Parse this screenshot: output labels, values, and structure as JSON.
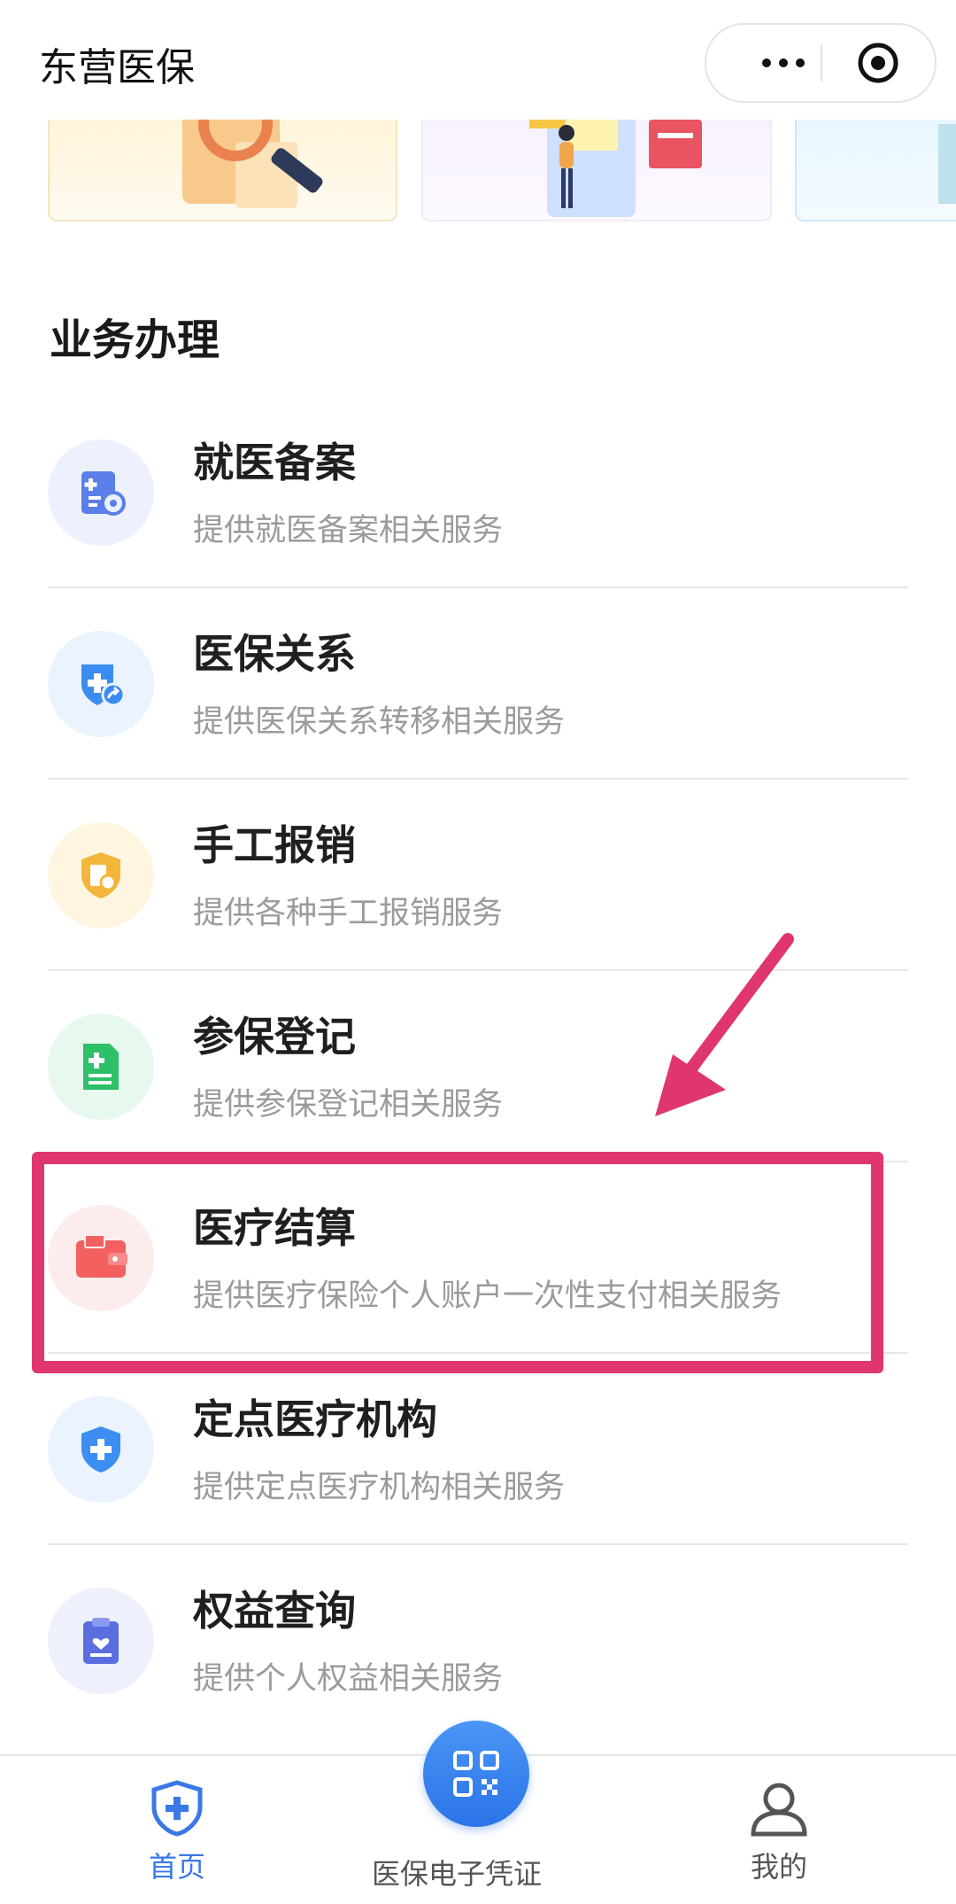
{
  "header": {
    "app_title": "东营医保",
    "more_icon": "more-dots-icon",
    "target_icon": "mini-program-close-icon"
  },
  "section": {
    "title": "业务办理"
  },
  "services": [
    {
      "title": "就医备案",
      "subtitle": "提供就医备案相关服务",
      "icon": "medical-record-gear-icon",
      "color": "#5b7fe8",
      "bg": "#edf1fd"
    },
    {
      "title": "医保关系",
      "subtitle": "提供医保关系转移相关服务",
      "icon": "shield-transfer-icon",
      "color": "#3b8cf0",
      "bg": "#eaf3fe"
    },
    {
      "title": "手工报销",
      "subtitle": "提供各种手工报销服务",
      "icon": "shield-receipt-icon",
      "color": "#f4b63a",
      "bg": "#fff6e2"
    },
    {
      "title": "参保登记",
      "subtitle": "提供参保登记相关服务",
      "icon": "document-plus-icon",
      "color": "#2cc068",
      "bg": "#e7f8ee"
    },
    {
      "title": "医疗结算",
      "subtitle": "提供医疗保险个人账户一次性支付相关服务",
      "icon": "wallet-card-icon",
      "color": "#f26060",
      "bg": "#fdecec"
    },
    {
      "title": "定点医疗机构",
      "subtitle": "提供定点医疗机构相关服务",
      "icon": "shield-plus-icon",
      "color": "#3d8ef2",
      "bg": "#eaf3fe"
    },
    {
      "title": "权益查询",
      "subtitle": "提供个人权益相关服务",
      "icon": "clipboard-heart-icon",
      "color": "#5a6ee0",
      "bg": "#eef0fc"
    }
  ],
  "annotation": {
    "highlight_color": "#e0366f",
    "highlighted_item": "医疗结算"
  },
  "tabbar": {
    "home": {
      "label": "首页",
      "icon": "shield-plus-icon",
      "color": "#3a78e6"
    },
    "center": {
      "label": "医保电子凭证",
      "icon": "qr-code-icon"
    },
    "mine": {
      "label": "我的",
      "icon": "user-icon"
    }
  }
}
